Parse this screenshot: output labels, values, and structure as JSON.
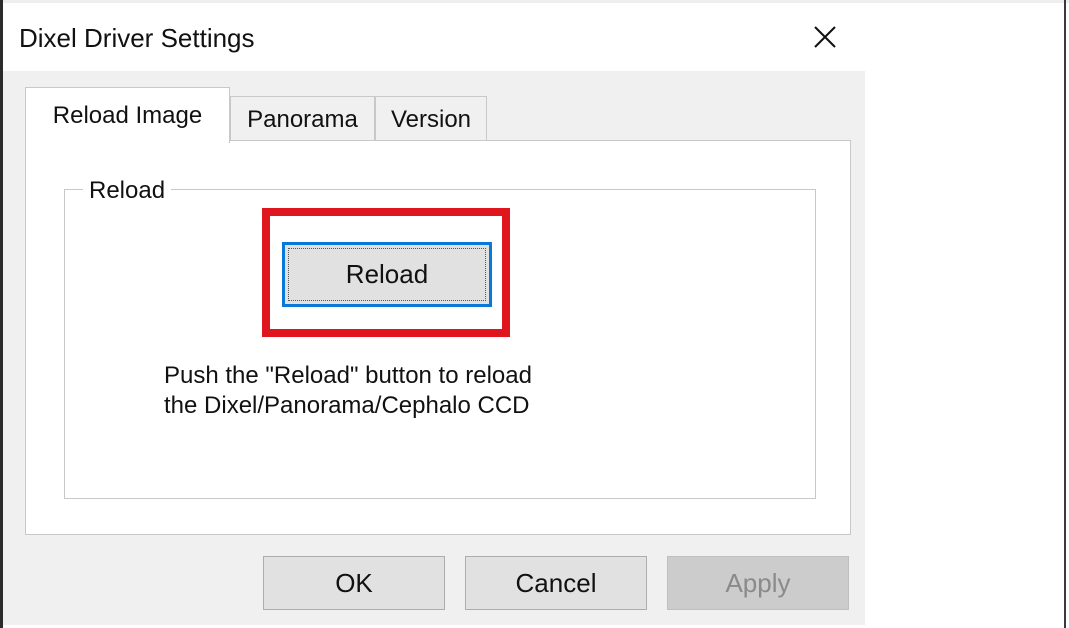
{
  "window": {
    "title": "Dixel Driver Settings",
    "close_icon": "close-icon"
  },
  "tabs": [
    {
      "label": "Reload Image",
      "active": true
    },
    {
      "label": "Panorama",
      "active": false
    },
    {
      "label": "Version",
      "active": false
    }
  ],
  "reload_group": {
    "label": "Reload",
    "button_label": "Reload",
    "instruction_line1": "Push the \"Reload\" button to reload",
    "instruction_line2": "the Dixel/Panorama/Cephalo CCD",
    "highlight_color": "#e0161e"
  },
  "footer": {
    "ok_label": "OK",
    "cancel_label": "Cancel",
    "apply_label": "Apply",
    "apply_enabled": false
  },
  "colors": {
    "focus_blue": "#0a78d7",
    "dialog_bg": "#f0f0f0"
  }
}
